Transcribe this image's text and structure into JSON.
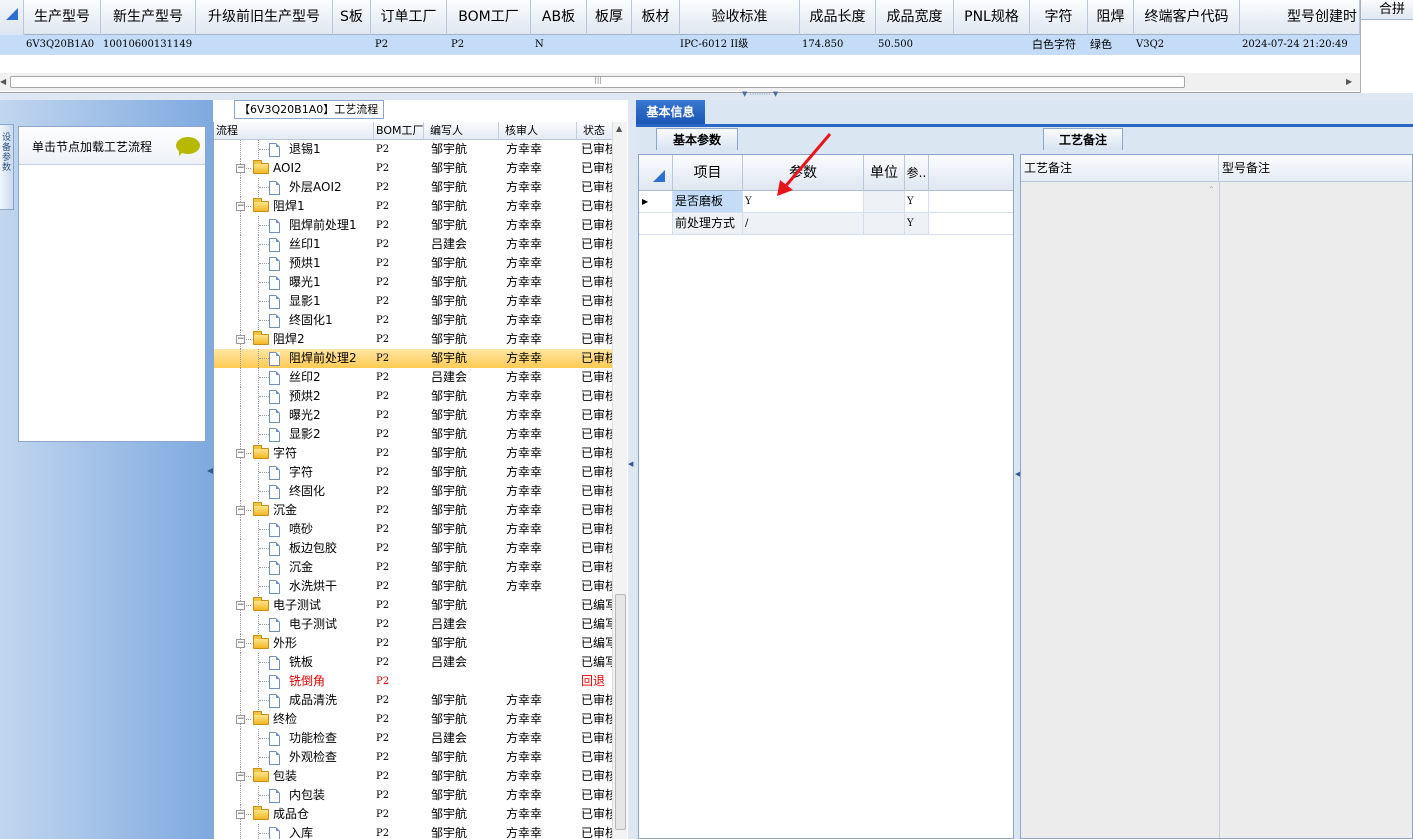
{
  "top_grid": {
    "columns": [
      "生产型号",
      "新生产型号",
      "升级前旧生产型号",
      "S板",
      "订单工厂",
      "BOM工厂",
      "AB板",
      "板厚",
      "板材",
      "验收标准",
      "成品长度",
      "成品宽度",
      "PNL规格",
      "字符",
      "阻焊",
      "终端客户代码",
      "型号创建时"
    ],
    "row": {
      "prod_model": "6V3Q20B1A0",
      "new_model": "10010600131149",
      "order_factory": "P2",
      "bom_factory": "P2",
      "ab_board": "N",
      "standard": "IPC-6012 II级",
      "length": "174.850",
      "width": "50.500",
      "silkscreen": "白色字符",
      "soldermask": "绿色",
      "customer_code": "V3Q2",
      "created": "2024-07-24 21:20:49"
    }
  },
  "right_box": {
    "header": "合拼"
  },
  "side_tab": {
    "label": "设备参数"
  },
  "node_panel": {
    "hint": "单击节点加载工艺流程"
  },
  "process_flow": {
    "title": "【6V3Q20B1A0】工艺流程",
    "columns": [
      "流程",
      "BOM工厂",
      "编写人",
      "核审人",
      "状态"
    ],
    "rows": [
      {
        "name": "退锡1",
        "bom": "P2",
        "writer": "邹宇航",
        "reviewer": "方幸幸",
        "status": "已审核",
        "level": 2,
        "type": "doc"
      },
      {
        "name": "AOI2",
        "bom": "P2",
        "writer": "邹宇航",
        "reviewer": "方幸幸",
        "status": "已审核",
        "level": 1,
        "type": "folder"
      },
      {
        "name": "外层AOI2",
        "bom": "P2",
        "writer": "邹宇航",
        "reviewer": "方幸幸",
        "status": "已审核",
        "level": 2,
        "type": "doc"
      },
      {
        "name": "阻焊1",
        "bom": "P2",
        "writer": "邹宇航",
        "reviewer": "方幸幸",
        "status": "已审核",
        "level": 1,
        "type": "folder"
      },
      {
        "name": "阻焊前处理1",
        "bom": "P2",
        "writer": "邹宇航",
        "reviewer": "方幸幸",
        "status": "已审核",
        "level": 2,
        "type": "doc"
      },
      {
        "name": "丝印1",
        "bom": "P2",
        "writer": "吕建会",
        "reviewer": "方幸幸",
        "status": "已审核",
        "level": 2,
        "type": "doc"
      },
      {
        "name": "预烘1",
        "bom": "P2",
        "writer": "邹宇航",
        "reviewer": "方幸幸",
        "status": "已审核",
        "level": 2,
        "type": "doc"
      },
      {
        "name": "曝光1",
        "bom": "P2",
        "writer": "邹宇航",
        "reviewer": "方幸幸",
        "status": "已审核",
        "level": 2,
        "type": "doc"
      },
      {
        "name": "显影1",
        "bom": "P2",
        "writer": "邹宇航",
        "reviewer": "方幸幸",
        "status": "已审核",
        "level": 2,
        "type": "doc"
      },
      {
        "name": "终固化1",
        "bom": "P2",
        "writer": "邹宇航",
        "reviewer": "方幸幸",
        "status": "已审核",
        "level": 2,
        "type": "doc"
      },
      {
        "name": "阻焊2",
        "bom": "P2",
        "writer": "邹宇航",
        "reviewer": "方幸幸",
        "status": "已审核",
        "level": 1,
        "type": "folder"
      },
      {
        "name": "阻焊前处理2",
        "bom": "P2",
        "writer": "邹宇航",
        "reviewer": "方幸幸",
        "status": "已审核",
        "level": 2,
        "type": "doc",
        "selected": true
      },
      {
        "name": "丝印2",
        "bom": "P2",
        "writer": "吕建会",
        "reviewer": "方幸幸",
        "status": "已审核",
        "level": 2,
        "type": "doc"
      },
      {
        "name": "预烘2",
        "bom": "P2",
        "writer": "邹宇航",
        "reviewer": "方幸幸",
        "status": "已审核",
        "level": 2,
        "type": "doc"
      },
      {
        "name": "曝光2",
        "bom": "P2",
        "writer": "邹宇航",
        "reviewer": "方幸幸",
        "status": "已审核",
        "level": 2,
        "type": "doc"
      },
      {
        "name": "显影2",
        "bom": "P2",
        "writer": "邹宇航",
        "reviewer": "方幸幸",
        "status": "已审核",
        "level": 2,
        "type": "doc"
      },
      {
        "name": "字符",
        "bom": "P2",
        "writer": "邹宇航",
        "reviewer": "方幸幸",
        "status": "已审核",
        "level": 1,
        "type": "folder"
      },
      {
        "name": "字符",
        "bom": "P2",
        "writer": "邹宇航",
        "reviewer": "方幸幸",
        "status": "已审核",
        "level": 2,
        "type": "doc"
      },
      {
        "name": "终固化",
        "bom": "P2",
        "writer": "邹宇航",
        "reviewer": "方幸幸",
        "status": "已审核",
        "level": 2,
        "type": "doc"
      },
      {
        "name": "沉金",
        "bom": "P2",
        "writer": "邹宇航",
        "reviewer": "方幸幸",
        "status": "已审核",
        "level": 1,
        "type": "folder"
      },
      {
        "name": "喷砂",
        "bom": "P2",
        "writer": "邹宇航",
        "reviewer": "方幸幸",
        "status": "已审核",
        "level": 2,
        "type": "doc"
      },
      {
        "name": "板边包胶",
        "bom": "P2",
        "writer": "邹宇航",
        "reviewer": "方幸幸",
        "status": "已审核",
        "level": 2,
        "type": "doc"
      },
      {
        "name": "沉金",
        "bom": "P2",
        "writer": "邹宇航",
        "reviewer": "方幸幸",
        "status": "已审核",
        "level": 2,
        "type": "doc"
      },
      {
        "name": "水洗烘干",
        "bom": "P2",
        "writer": "邹宇航",
        "reviewer": "方幸幸",
        "status": "已审核",
        "level": 2,
        "type": "doc"
      },
      {
        "name": "电子测试",
        "bom": "P2",
        "writer": "邹宇航",
        "reviewer": "",
        "status": "已编写",
        "level": 1,
        "type": "folder"
      },
      {
        "name": "电子测试",
        "bom": "P2",
        "writer": "吕建会",
        "reviewer": "",
        "status": "已编写",
        "level": 2,
        "type": "doc"
      },
      {
        "name": "外形",
        "bom": "P2",
        "writer": "邹宇航",
        "reviewer": "",
        "status": "已编写",
        "level": 1,
        "type": "folder"
      },
      {
        "name": "铣板",
        "bom": "P2",
        "writer": "吕建会",
        "reviewer": "",
        "status": "已编写",
        "level": 2,
        "type": "doc"
      },
      {
        "name": "铣倒角",
        "bom": "P2",
        "writer": "",
        "reviewer": "",
        "status": "回退",
        "level": 2,
        "type": "doc",
        "red": true
      },
      {
        "name": "成品清洗",
        "bom": "P2",
        "writer": "邹宇航",
        "reviewer": "方幸幸",
        "status": "已审核",
        "level": 2,
        "type": "doc"
      },
      {
        "name": "终检",
        "bom": "P2",
        "writer": "邹宇航",
        "reviewer": "方幸幸",
        "status": "已审核",
        "level": 1,
        "type": "folder"
      },
      {
        "name": "功能检查",
        "bom": "P2",
        "writer": "吕建会",
        "reviewer": "方幸幸",
        "status": "已审核",
        "level": 2,
        "type": "doc"
      },
      {
        "name": "外观检查",
        "bom": "P2",
        "writer": "邹宇航",
        "reviewer": "方幸幸",
        "status": "已审核",
        "level": 2,
        "type": "doc"
      },
      {
        "name": "包装",
        "bom": "P2",
        "writer": "邹宇航",
        "reviewer": "方幸幸",
        "status": "已审核",
        "level": 1,
        "type": "folder"
      },
      {
        "name": "内包装",
        "bom": "P2",
        "writer": "邹宇航",
        "reviewer": "方幸幸",
        "status": "已审核",
        "level": 2,
        "type": "doc"
      },
      {
        "name": "成品仓",
        "bom": "P2",
        "writer": "邹宇航",
        "reviewer": "方幸幸",
        "status": "已审核",
        "level": 1,
        "type": "folder"
      },
      {
        "name": "入库",
        "bom": "P2",
        "writer": "邹宇航",
        "reviewer": "方幸幸",
        "status": "已审核",
        "level": 2,
        "type": "doc"
      }
    ]
  },
  "right_pane": {
    "tab": "基本信息",
    "subtab_params": "基本参数",
    "subtab_remarks": "工艺备注",
    "param_columns": [
      "项目",
      "参数",
      "单位",
      "参.."
    ],
    "params": [
      {
        "item": "是否磨板",
        "value": "Y",
        "unit": "",
        "flag": "Y"
      },
      {
        "item": "前处理方式",
        "value": "/",
        "unit": "",
        "flag": "Y"
      }
    ],
    "remark_columns": [
      "工艺备注",
      "型号备注"
    ]
  },
  "colors": {
    "accent": "#1a56b4",
    "selection": "#ffcb52",
    "row_highlight": "#c4dcf8",
    "arrow": "#e8141c"
  }
}
